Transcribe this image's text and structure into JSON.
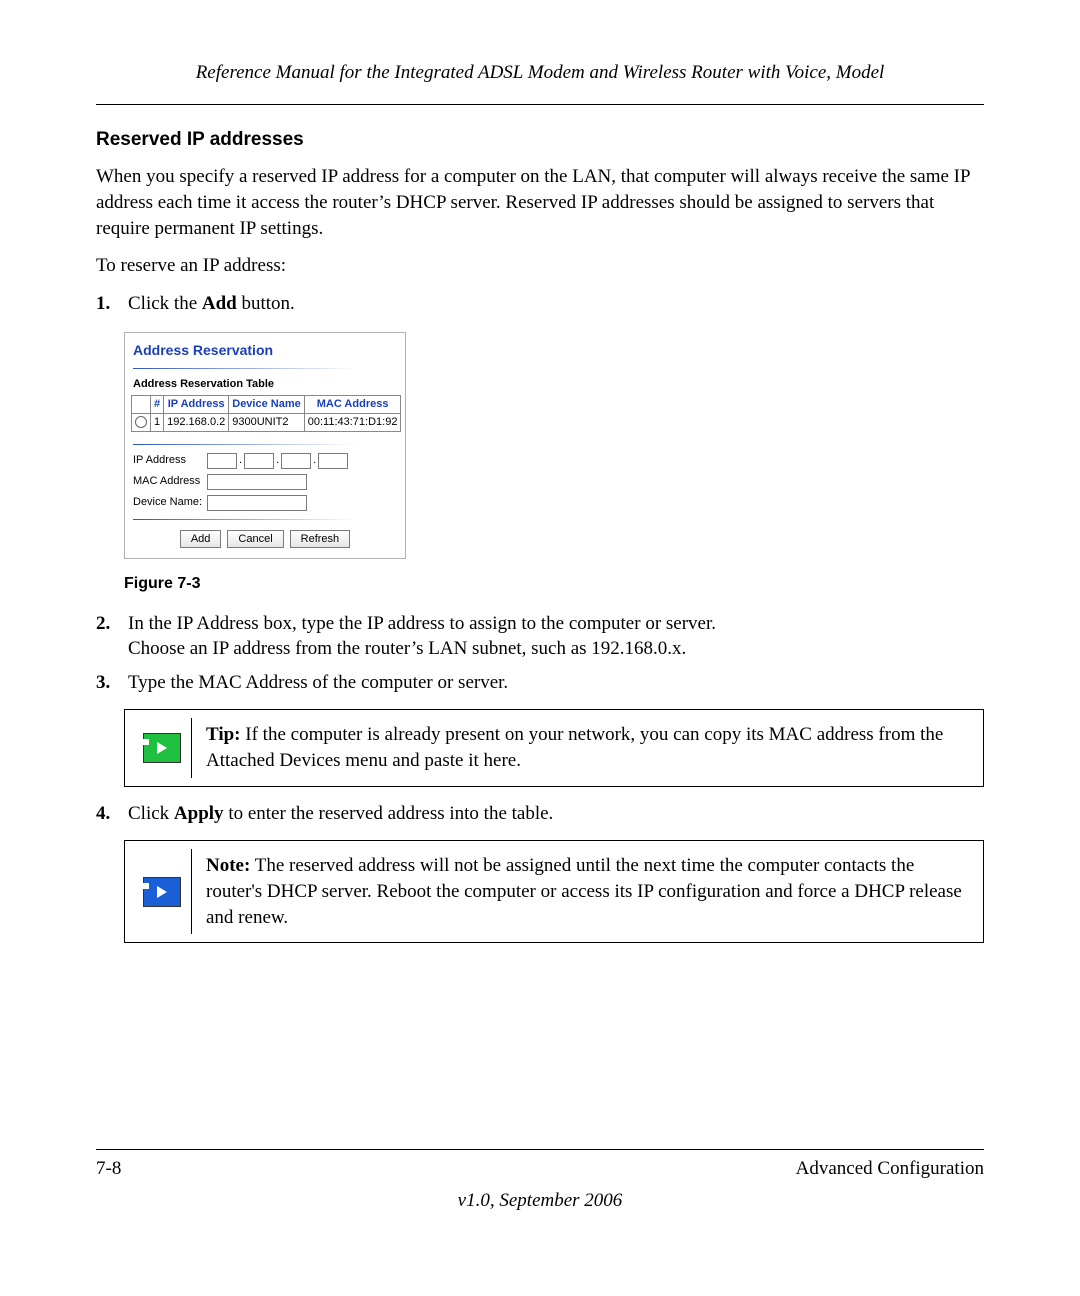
{
  "running_head": "Reference Manual for the Integrated ADSL Modem and Wireless Router with Voice, Model",
  "section_heading": "Reserved IP addresses",
  "intro_para": "When you specify a reserved IP address for a computer on the LAN, that computer will always receive the same IP address each time it access the router’s DHCP server. Reserved IP addresses should be assigned to servers that require permanent IP settings.",
  "lead_in": "To reserve an IP address:",
  "step1_num": "1.",
  "step1_prefix": "Click the ",
  "step1_bold": "Add",
  "step1_suffix": " button.",
  "figure": {
    "panel_title": "Address Reservation",
    "table_caption": "Address Reservation Table",
    "headers": {
      "num": "#",
      "ip": "IP Address",
      "dev": "Device Name",
      "mac": "MAC Address"
    },
    "row": {
      "num": "1",
      "ip": "192.168.0.2",
      "dev": "9300UNIT2",
      "mac": "00:11:43:71:D1:92"
    },
    "labels": {
      "ip": "IP Address",
      "mac": "MAC Address",
      "device": "Device Name:"
    },
    "buttons": {
      "add": "Add",
      "cancel": "Cancel",
      "refresh": "Refresh"
    }
  },
  "figure_caption": "Figure 7-3",
  "step2_num": "2.",
  "step2_line1": "In the IP Address box, type the IP address to assign to the computer or server.",
  "step2_line2": "Choose an IP address from the router’s LAN subnet, such as 192.168.0.x.",
  "step3_num": "3.",
  "step3_text": "Type the MAC Address of the computer or server.",
  "tip_label": "Tip:",
  "tip_text": " If the computer is already present on your network, you can copy its MAC address from the Attached Devices menu and paste it here.",
  "step4_num": "4.",
  "step4_prefix": "Click ",
  "step4_bold": "Apply",
  "step4_suffix": " to enter the reserved address into the table.",
  "note_label": "Note:",
  "note_text": " The reserved address will not be assigned until the next time the computer contacts the router's DHCP server. Reboot the computer or access its IP configuration and force a DHCP release and renew.",
  "footer": {
    "page": "7-8",
    "section": "Advanced Configuration",
    "version": "v1.0, September 2006"
  }
}
